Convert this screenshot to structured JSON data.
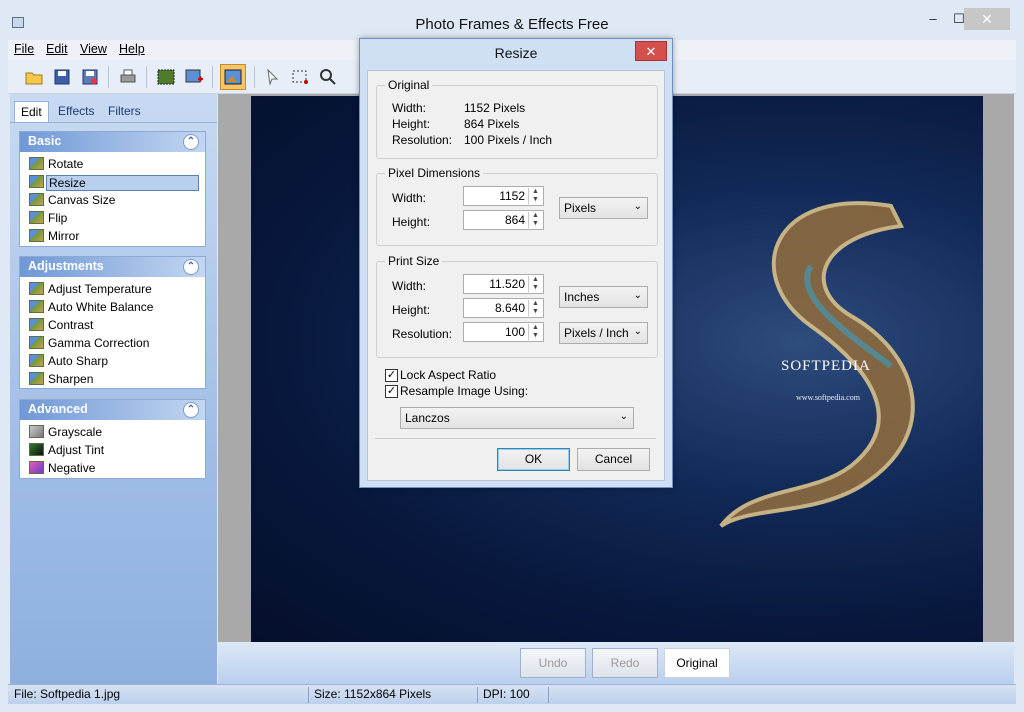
{
  "window": {
    "title": "Photo Frames & Effects Free",
    "minimize": "–",
    "maximize": "☐",
    "close": "✕"
  },
  "menu": [
    {
      "label": "File"
    },
    {
      "label": "Edit"
    },
    {
      "label": "View"
    },
    {
      "label": "Help"
    }
  ],
  "toolbar": {
    "icons": [
      "open-folder-icon",
      "save-icon",
      "save-as-icon",
      "print-icon",
      "select-frame-icon",
      "add-image-icon",
      "active-tool-icon",
      "pointer-icon",
      "rect-select-icon",
      "zoom-icon"
    ]
  },
  "tabs": [
    {
      "label": "Edit"
    },
    {
      "label": "Effects"
    },
    {
      "label": "Filters"
    }
  ],
  "groups": {
    "basic": {
      "title": "Basic",
      "items": [
        "Rotate",
        "Resize",
        "Canvas Size",
        "Flip",
        "Mirror"
      ],
      "selected": "Resize"
    },
    "adjustments": {
      "title": "Adjustments",
      "items": [
        "Adjust Temperature",
        "Auto White Balance",
        "Contrast",
        "Gamma Correction",
        "Auto Sharp",
        "Sharpen"
      ]
    },
    "advanced": {
      "title": "Advanced",
      "items": [
        "Grayscale",
        "Adjust Tint",
        "Negative"
      ]
    }
  },
  "image": {
    "watermark": "SOFTPEDIA",
    "site": "www.softpedia.com"
  },
  "bottom": {
    "undo": "Undo",
    "redo": "Redo",
    "original": "Original"
  },
  "status": {
    "file": "File: Softpedia 1.jpg",
    "size": "Size: 1152x864 Pixels",
    "dpi": "DPI: 100"
  },
  "dialog": {
    "title": "Resize",
    "close": "✕",
    "original": {
      "legend": "Original",
      "width_label": "Width:",
      "width_value": "1152 Pixels",
      "height_label": "Height:",
      "height_value": "864 Pixels",
      "res_label": "Resolution:",
      "res_value": "100 Pixels / Inch"
    },
    "pixel": {
      "legend": "Pixel Dimensions",
      "width_label": "Width:",
      "width_value": "1152",
      "height_label": "Height:",
      "height_value": "864",
      "unit": "Pixels"
    },
    "print": {
      "legend": "Print Size",
      "width_label": "Width:",
      "width_value": "11.520",
      "height_label": "Height:",
      "height_value": "8.640",
      "res_label": "Resolution:",
      "res_value": "100",
      "unit": "Inches",
      "res_unit": "Pixels / Inch"
    },
    "lock_label": "Lock Aspect Ratio",
    "resample_label": "Resample Image Using:",
    "resample_method": "Lanczos",
    "ok": "OK",
    "cancel": "Cancel"
  }
}
